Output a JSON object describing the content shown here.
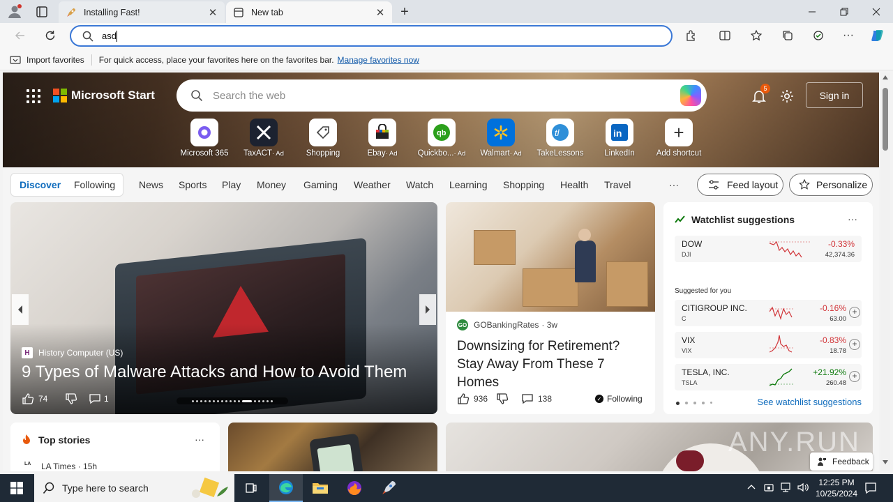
{
  "browser": {
    "tabs": [
      {
        "label": "Installing Fast!",
        "active": false
      },
      {
        "label": "New tab",
        "active": true
      }
    ],
    "address_value": "asd",
    "favorites_bar": {
      "import_label": "Import favorites",
      "hint": "For quick access, place your favorites here on the favorites bar.",
      "manage_link": "Manage favorites now"
    }
  },
  "hero": {
    "brand": "Microsoft Start",
    "search_placeholder": "Search the web",
    "notification_count": "5",
    "signin_label": "Sign in",
    "shortcuts": [
      {
        "label": "Microsoft 365",
        "ad": "",
        "icon": "microsoft-365-icon"
      },
      {
        "label": "TaxACT",
        "ad": "· Ad",
        "icon": "taxact-icon"
      },
      {
        "label": "Shopping",
        "ad": "",
        "icon": "shopping-tag-icon"
      },
      {
        "label": "Ebay",
        "ad": "· Ad",
        "icon": "ebay-icon"
      },
      {
        "label": "Quickbo...",
        "ad": "· Ad",
        "icon": "quickbooks-icon"
      },
      {
        "label": "Walmart",
        "ad": "· Ad",
        "icon": "walmart-icon"
      },
      {
        "label": "TakeLessons",
        "ad": "",
        "icon": "takelessons-icon"
      },
      {
        "label": "LinkedIn",
        "ad": "",
        "icon": "linkedin-icon"
      },
      {
        "label": "Add shortcut",
        "ad": "",
        "icon": "plus-icon"
      }
    ]
  },
  "nav": {
    "tabs": [
      "Discover",
      "Following"
    ],
    "items": [
      "News",
      "Sports",
      "Play",
      "Money",
      "Gaming",
      "Weather",
      "Watch",
      "Learning",
      "Shopping",
      "Health",
      "Travel"
    ],
    "more": "···",
    "feed_layout": "Feed layout",
    "personalize": "Personalize"
  },
  "main_card": {
    "source": "History Computer (US)",
    "title": "9 Types of Malware Attacks and How to Avoid Them",
    "likes": "74",
    "comments": "1"
  },
  "card2": {
    "source": "GOBankingRates",
    "age": "· 3w",
    "title": "Downsizing for Retirement? Stay Away From These 7 Homes",
    "likes": "936",
    "comments": "138",
    "following": "Following"
  },
  "watchlist": {
    "title": "Watchlist suggestions",
    "more": "···",
    "suggested_label": "Suggested for you",
    "see_more": "See watchlist suggestions",
    "items": [
      {
        "name": "DOW",
        "symbol": "DJI",
        "change": "-0.33%",
        "price": "42,374.36",
        "dir": "neg"
      },
      {
        "name": "CITIGROUP INC.",
        "symbol": "C",
        "change": "-0.16%",
        "price": "63.00",
        "dir": "neg"
      },
      {
        "name": "VIX",
        "symbol": "VIX",
        "change": "-0.83%",
        "price": "18.78",
        "dir": "neg"
      },
      {
        "name": "TESLA, INC.",
        "symbol": "TSLA",
        "change": "+21.92%",
        "price": "260.48",
        "dir": "pos"
      }
    ]
  },
  "top_stories": {
    "title": "Top stories",
    "more": "···",
    "first_source": "LA Times · 15h"
  },
  "feedback_label": "Feedback",
  "watermark": "ANY.RUN",
  "taskbar": {
    "search_placeholder": "Type here to search",
    "time": "12:25 PM",
    "date": "10/25/2024"
  }
}
